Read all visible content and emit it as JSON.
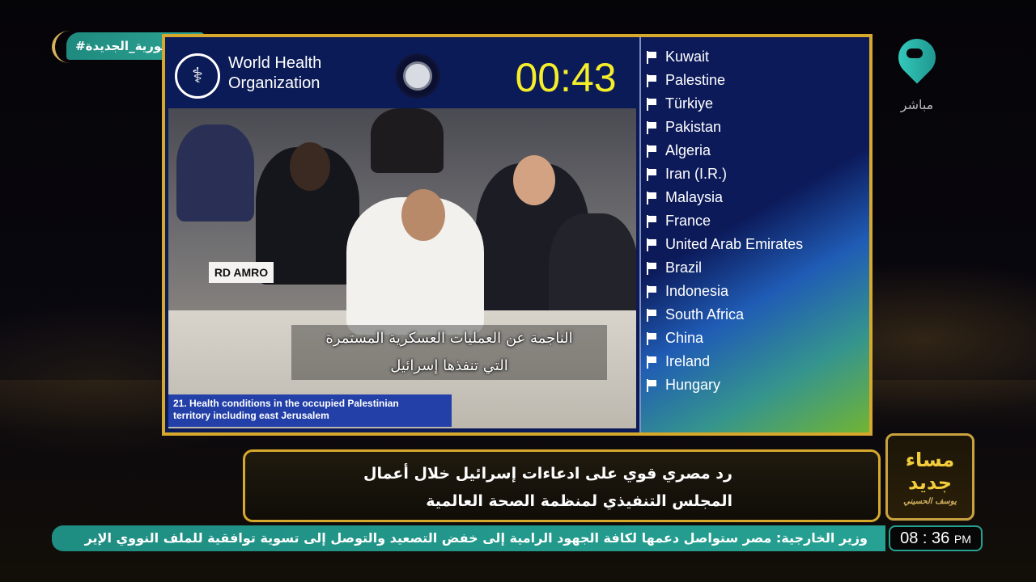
{
  "hashtag": "#الجمهورية_الجديدة",
  "channel": {
    "live_label": "مباشر"
  },
  "who": {
    "name_line1": "World Health",
    "name_line2": "Organization",
    "logo_icon": "who-emblem-icon"
  },
  "timer": "00:43",
  "video": {
    "nameplate": "RD AMRO",
    "subtitle_line1": "الناجمة عن العمليات العسكرية المستمرة",
    "subtitle_line2": "التي تنفذها إسرائيل",
    "agenda_line1": "21. Health conditions in the occupied Palestinian",
    "agenda_line2": "territory including east Jerusalem"
  },
  "speakers": [
    "Kuwait",
    "Palestine",
    "Türkiye",
    "Pakistan",
    "Algeria",
    "Iran (I.R.)",
    "Malaysia",
    "France",
    "United Arab Emirates",
    "Brazil",
    "Indonesia",
    "South Africa",
    "China",
    "Ireland",
    "Hungary"
  ],
  "caption": {
    "line1": "رد مصري قوي على ادعاءات إسرائيل خلال أعمال",
    "line2": "المجلس التنفيذي لمنظمة الصحة العالمية"
  },
  "program": {
    "line1": "مساء",
    "line2": "جديد",
    "signature": "يوسف الحسيني"
  },
  "ticker": "وزير الخارجية: مصر ستواصل دعمها لكافة الجهود الرامية إلى خفض التصعيد والتوصل إلى تسوية توافقية للملف النووي الإير",
  "clock": {
    "time": "08 : 36",
    "ampm": "PM"
  },
  "colors": {
    "gold": "#d6a82c",
    "teal": "#26a193",
    "timer": "#f5ee2a",
    "who_blue": "#0b1b57"
  }
}
